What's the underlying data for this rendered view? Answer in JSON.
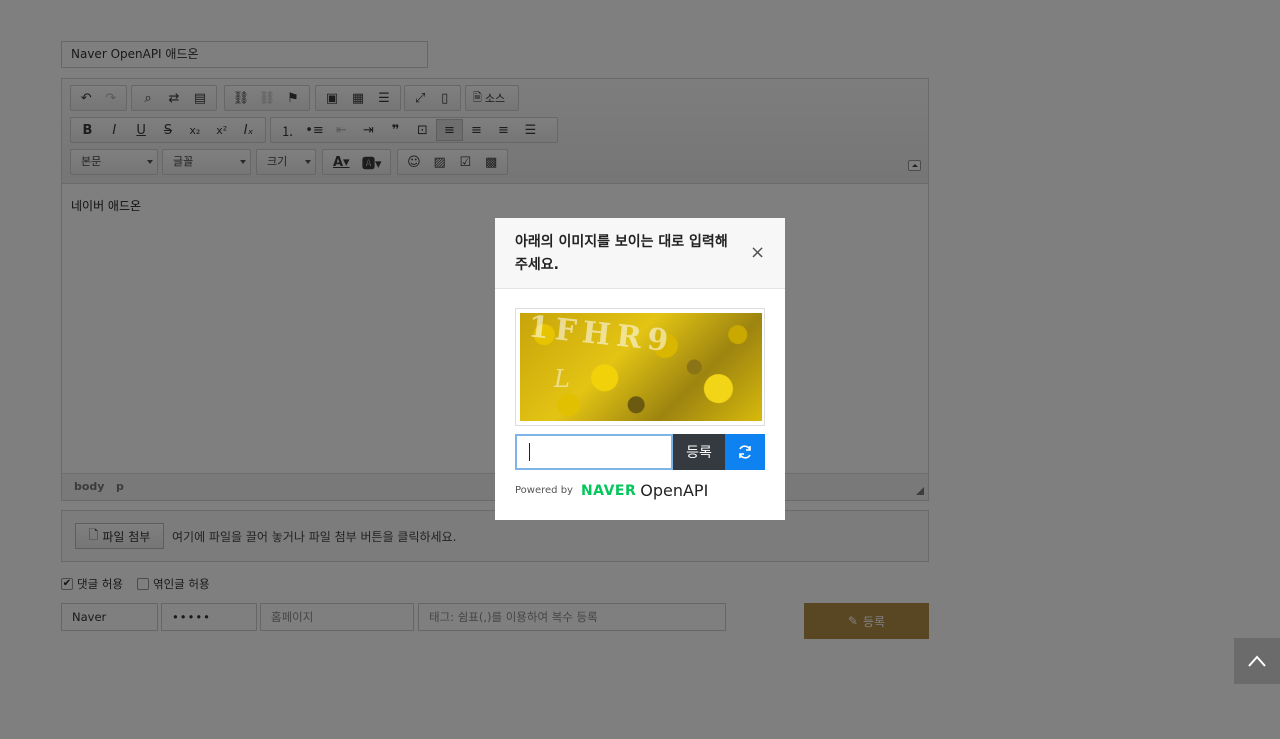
{
  "post": {
    "title_value": "Naver OpenAPI 애드온",
    "body_text": "네이버 애드온"
  },
  "toolbar": {
    "source_label": "소스",
    "format_select": "본문",
    "font_select": "글꼴",
    "size_select": "크기"
  },
  "statusbar": {
    "path": [
      "body",
      "p"
    ]
  },
  "attachments": {
    "button_label": "파일 첨부",
    "hint": "여기에 파일을 끌어 놓거나 파일 첨부 버튼을 클릭하세요."
  },
  "options": {
    "allow_comments_label": "댓글 허용",
    "allow_comments_checked": true,
    "allow_trackback_label": "엮인글 허용",
    "allow_trackback_checked": false
  },
  "author": {
    "name_value": "Naver",
    "password_value": "•••••",
    "homepage_placeholder": "홈페이지",
    "tags_placeholder": "태그: 쉼표(,)를 이용하여 복수 등록"
  },
  "submit": {
    "label": "등록"
  },
  "captcha_modal": {
    "title": "아래의 이미지를 보이는 대로 입력해 주세요.",
    "close_glyph": "×",
    "image_text_line1": "1FHR9",
    "image_text_line2": "L",
    "input_value": "",
    "submit_label": "등록",
    "powered_by": "Powered by",
    "brand_naver": "NAVER",
    "brand_openapi": "OpenAPI"
  },
  "colors": {
    "submit_bg": "#b38c47",
    "refresh_bg": "#0d82f0",
    "captcha_submit_bg": "#343a40",
    "naver_green": "#03c75a"
  }
}
